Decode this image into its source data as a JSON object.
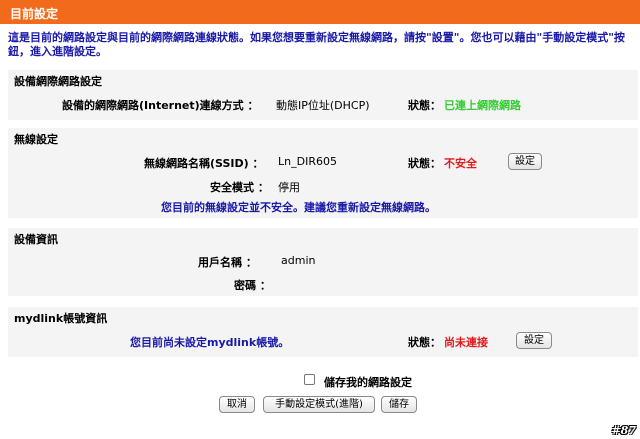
{
  "header": {
    "title": "目前設定"
  },
  "intro": {
    "text": "這是目前的網路設定與目前的網際網路連線狀態。如果您想要重新設定無線網路，請按\"設置\"。您也可以藉由\"手動設定模式\"按鈕，進入進階設定。"
  },
  "internet": {
    "title": "設備網際網路設定",
    "conn_label": "設備的網際網路(Internet)連線方式 ：",
    "conn_value": "動態IP位址(DHCP)",
    "status_label": "狀態：",
    "status_value": "已連上網際網路",
    "status_color": "#33cc33"
  },
  "wireless": {
    "title": "無線設定",
    "ssid_label": "無線網路名稱(SSID) ：",
    "ssid_value": "Ln_DIR605",
    "status_label": "狀態：",
    "status_value": "不安全",
    "setup_button": "設定",
    "security_label": "安全模式 ：",
    "security_value": "停用",
    "warning": "您目前的無線設定並不安全。建議您重新設定無線網路。"
  },
  "device": {
    "title": "設備資訊",
    "user_label": "用戶名稱 ：",
    "user_value": "admin",
    "password_label": "密碼 ："
  },
  "mydlink": {
    "title": "mydlink帳號資訊",
    "message": "您目前尚未設定mydlink帳號。",
    "status_label": "狀態：",
    "status_value": "尚未連接",
    "setup_button": "設定"
  },
  "footer": {
    "save_checkbox_label": "儲存我的網路設定",
    "save_checked": false,
    "cancel_button": "取消",
    "manual_button": "手動設定模式(進階)",
    "save_button": "儲存"
  },
  "watermark": "#87",
  "colors": {
    "header_bg": "#f26a1b",
    "text_blue": "#1a1aa8",
    "status_red": "#e01b1b",
    "status_green": "#33cc33",
    "section_bg": "#f4f4f4"
  }
}
